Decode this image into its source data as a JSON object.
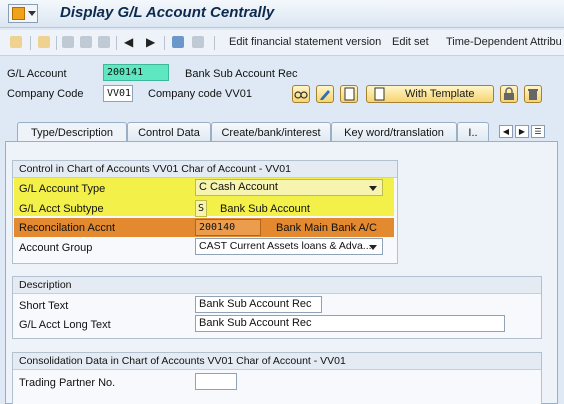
{
  "window": {
    "title": "Display G/L Account Centrally"
  },
  "toolbar": {
    "items": [
      "Edit financial statement version",
      "Edit set",
      "Time-Dependent Attribu"
    ]
  },
  "header": {
    "gl_account_label": "G/L Account",
    "gl_account_value": "200141",
    "gl_account_desc": "Bank Sub Account Rec",
    "company_code_label": "Company Code",
    "company_code_value": "VV01",
    "company_code_desc": "Company code VV01",
    "with_template_label": "With Template"
  },
  "tabs": [
    {
      "label": "Type/Description",
      "active": true
    },
    {
      "label": "Control Data",
      "active": false
    },
    {
      "label": "Create/bank/interest",
      "active": false
    },
    {
      "label": "Key word/translation",
      "active": false
    },
    {
      "label": "I..",
      "active": false
    }
  ],
  "control_group": {
    "title": "Control in Chart of Accounts VV01 Char of Account - VV01",
    "rows": {
      "account_type_label": "G/L Account Type",
      "account_type_value": "C Cash Account",
      "subtype_label": "G/L Acct Subtype",
      "subtype_value": "S",
      "subtype_desc": "Bank Sub Account",
      "recon_label": "Reconcilation Accnt",
      "recon_value": "200140",
      "recon_desc": "Bank Main Bank A/C",
      "account_group_label": "Account Group",
      "account_group_value": "CAST Current Assets loans & Adva..."
    }
  },
  "description_group": {
    "title": "Description",
    "short_text_label": "Short Text",
    "short_text_value": "Bank Sub Account Rec",
    "long_text_label": "G/L Acct Long Text",
    "long_text_value": "Bank Sub Account Rec"
  },
  "consolidation_group": {
    "title": "Consolidation Data in Chart of Accounts VV01 Char of Account - VV01",
    "trading_partner_label": "Trading Partner No.",
    "trading_partner_value": ""
  },
  "colors": {
    "highlight_yellow": "#f3f04a",
    "highlight_orange": "#e3892f",
    "gl_account_field": "#5de8c2"
  }
}
